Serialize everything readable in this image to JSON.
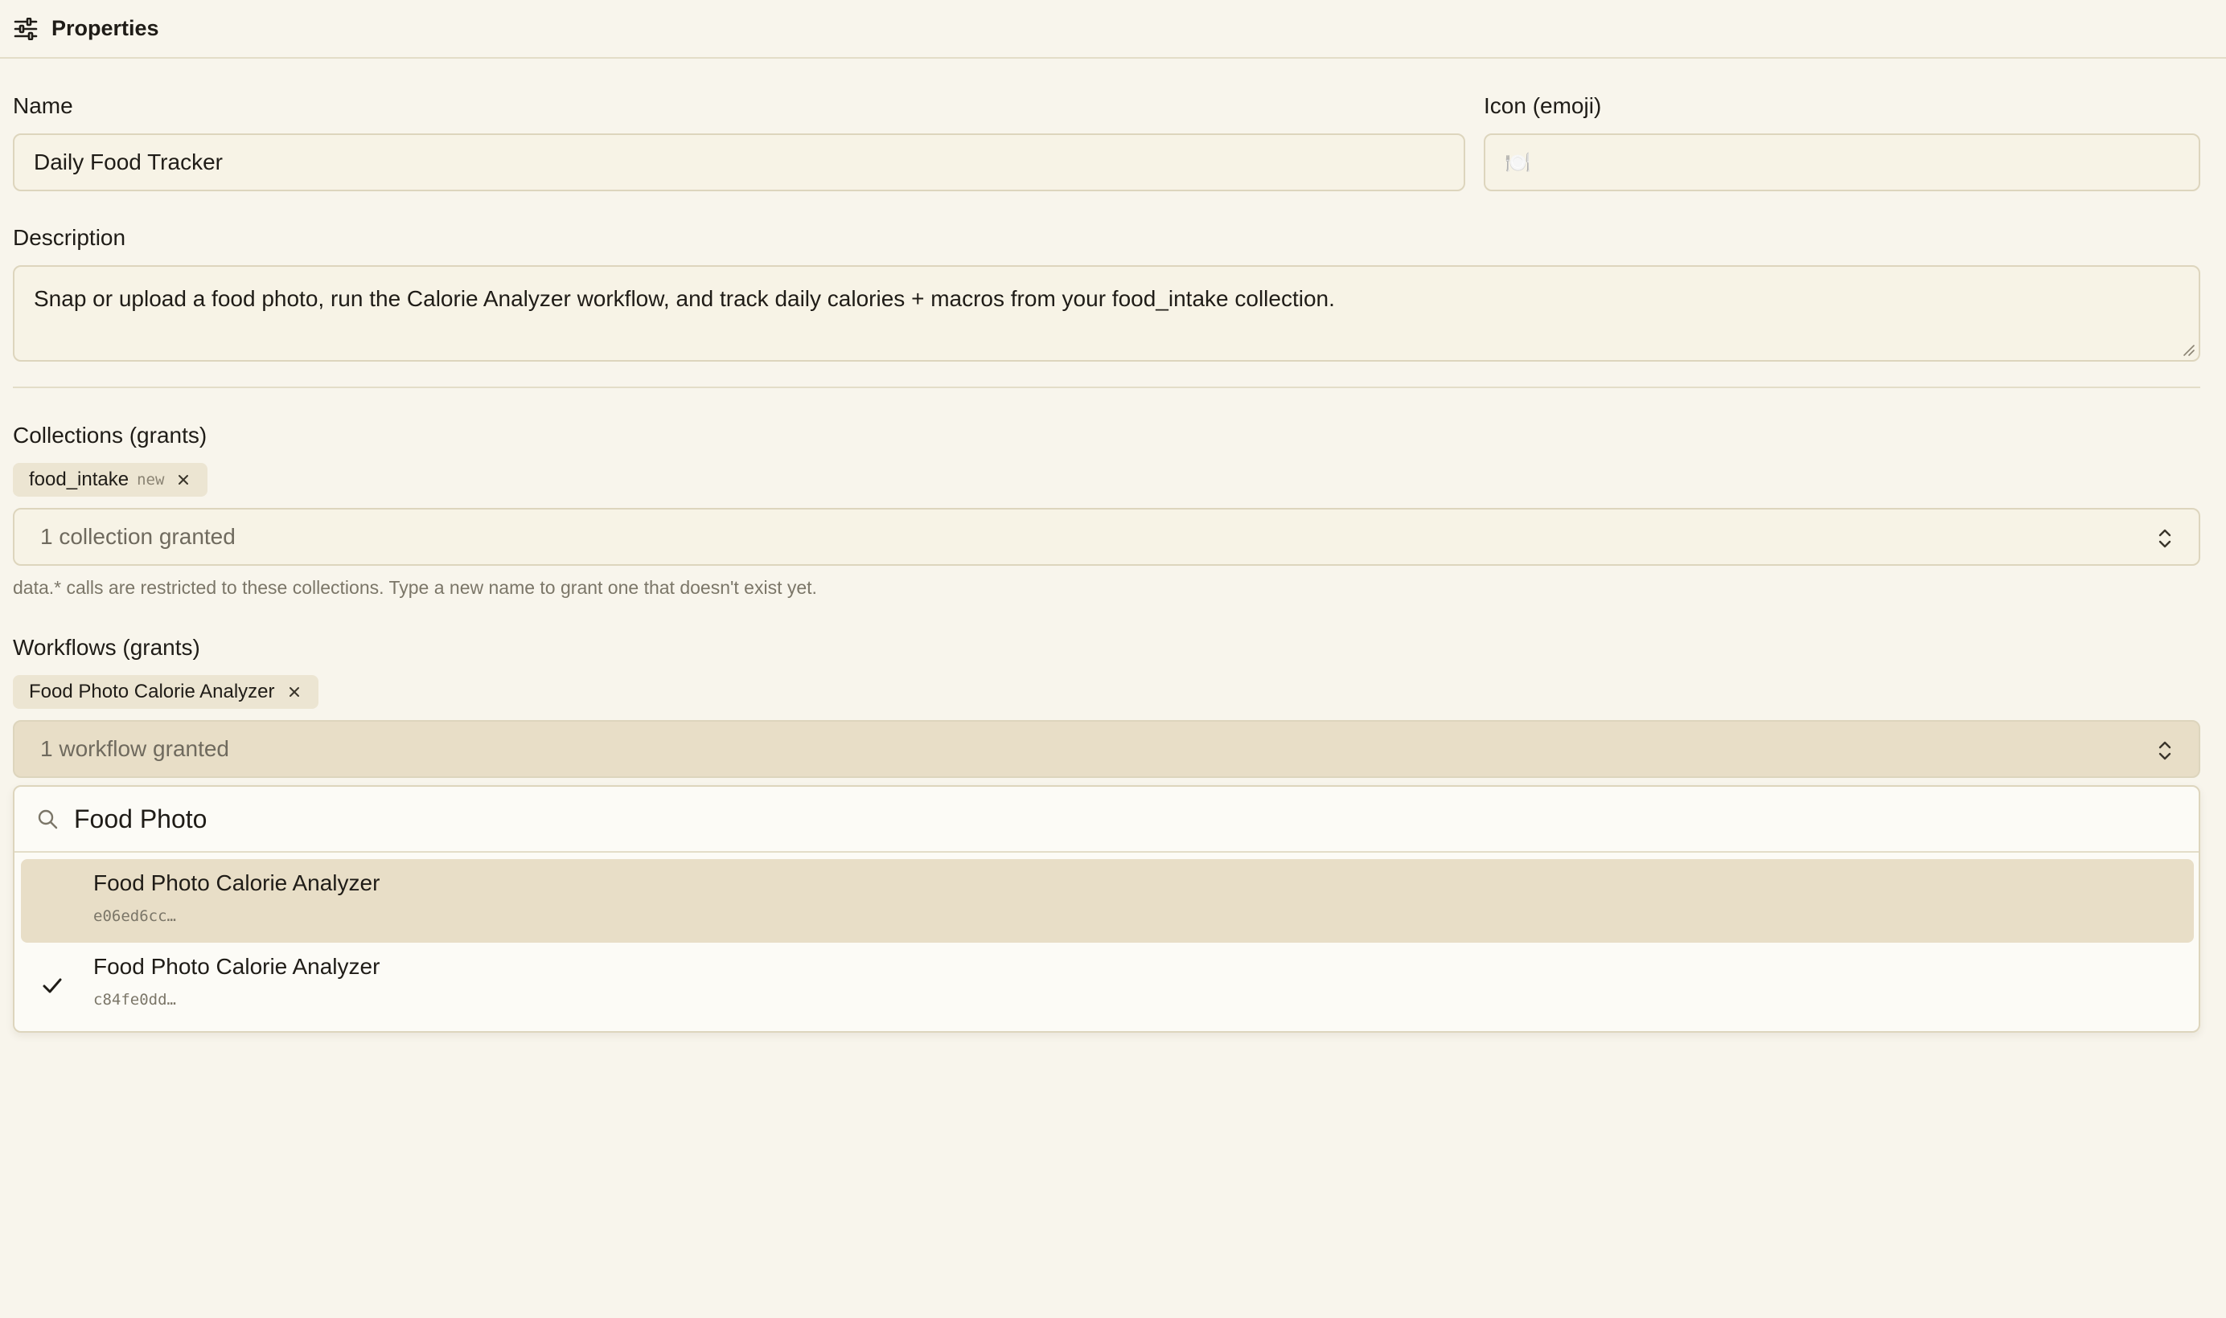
{
  "header": {
    "title": "Properties",
    "icon": "sliders-icon"
  },
  "name_field": {
    "label": "Name",
    "value": "Daily Food Tracker"
  },
  "icon_field": {
    "label": "Icon (emoji)",
    "value": "🍽️"
  },
  "description_field": {
    "label": "Description",
    "value": "Snap or upload a food photo, run the Calorie Analyzer workflow, and track daily calories + macros from your food_intake collection."
  },
  "collections": {
    "label": "Collections (grants)",
    "chips": [
      {
        "name": "food_intake",
        "tag": "new"
      }
    ],
    "select_text": "1 collection granted",
    "hint": "data.* calls are restricted to these collections. Type a new name to grant one that doesn't exist yet."
  },
  "workflows": {
    "label": "Workflows (grants)",
    "chips": [
      {
        "name": "Food Photo Calorie Analyzer"
      }
    ],
    "select_text": "1 workflow granted",
    "search_query": "Food Photo",
    "options": [
      {
        "name": "Food Photo Calorie Analyzer",
        "id": "e06ed6cc…",
        "selected": false,
        "highlighted": true
      },
      {
        "name": "Food Photo Calorie Analyzer",
        "id": "c84fe0dd…",
        "selected": true,
        "highlighted": false
      }
    ]
  },
  "colors": {
    "background": "#f8f5ec",
    "input_bg": "#f7f3e6",
    "border": "#ddd5bd",
    "highlight": "#e8dec7",
    "chip_bg": "#ece5d2"
  }
}
